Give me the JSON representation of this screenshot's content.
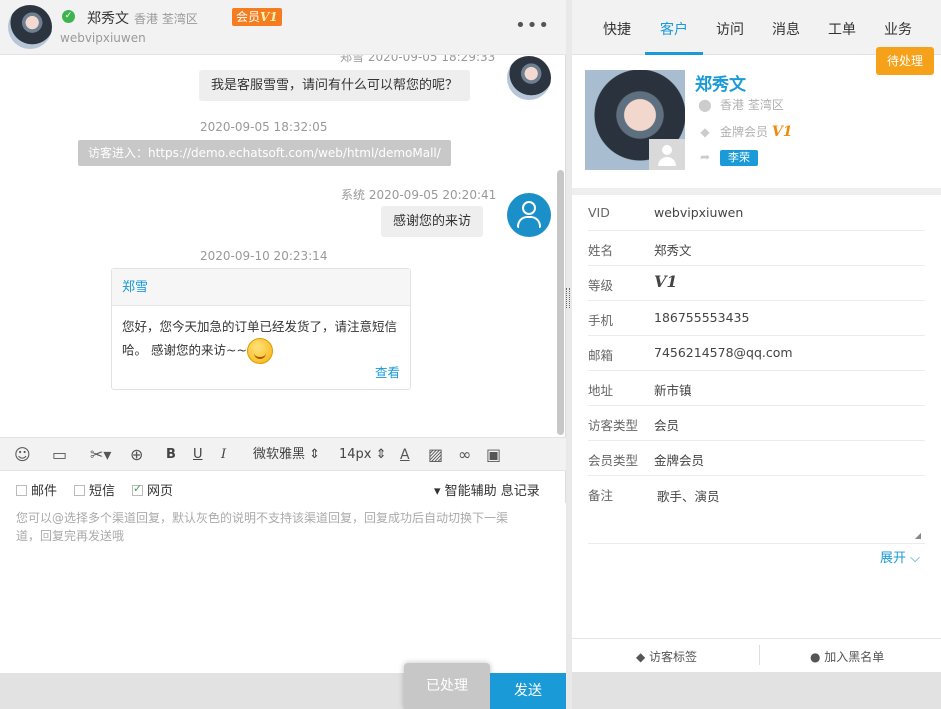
{
  "chat_header": {
    "name": "郑秀文",
    "region": "香港 荃湾区",
    "member_label": "会员",
    "member_level": "V1",
    "vid": "webvipxiuwen",
    "more": "•••"
  },
  "messages": {
    "msg1_meta": "郑雪  2020-09-05 18:29:33",
    "msg1_text": "我是客服雪雪，请问有什么可以帮您的呢？",
    "ts2": "2020-09-05 18:32:05",
    "visitor_enter": "访客进入：https://demo.echatsoft.com/web/html/demoMall/",
    "msg3_meta": "系统  2020-09-05 20:20:41",
    "msg3_text": "感谢您的来访",
    "ts4": "2020-09-10 20:23:14",
    "card_title": "郑雪",
    "card_text": "您好，您今天加急的订单已经发货了，请注意短信哈。 感谢您的来访~~",
    "card_link": "查看"
  },
  "toolbar": {
    "font": "微软雅黑 ⇕",
    "size": "14px ⇕",
    "bold": "B",
    "underline": "U",
    "italic": "I"
  },
  "channels": {
    "mail": "邮件",
    "sms": "短信",
    "web": "网页",
    "assist": "▾ 智能辅助 息记录"
  },
  "compose": {
    "placeholder": "您可以@选择多个渠道回复，默认灰色的说明不支持该渠道回复，回复成功后自动切换下一渠道，回复完再发送哦"
  },
  "buttons": {
    "done": "已处理",
    "send": "发送",
    "pending": "待处理"
  },
  "tabs": [
    "快捷",
    "客户",
    "访问",
    "消息",
    "工单",
    "业务"
  ],
  "profile": {
    "name": "郑秀文",
    "location": "香港 荃湾区",
    "level_name": "金牌会员",
    "level": "V1",
    "agent": "李荣"
  },
  "fields": [
    {
      "label": "VID",
      "value": "webvipxiuwen"
    },
    {
      "label": "姓名",
      "value": "郑秀文"
    },
    {
      "label": "等级",
      "value": "V1"
    },
    {
      "label": "手机",
      "value": "186755553435"
    },
    {
      "label": "邮箱",
      "value": "7456214578@qq.com"
    },
    {
      "label": "地址",
      "value": "新市镇"
    },
    {
      "label": "访客类型",
      "value": "会员"
    },
    {
      "label": "会员类型",
      "value": "金牌会员"
    },
    {
      "label": "备注",
      "value": "歌手、演员"
    }
  ],
  "expand": "展开 ⌵",
  "actions": {
    "tags": "访客标签",
    "blacklist": "加入黑名单"
  },
  "colors": {
    "accent": "#1a9bd7",
    "member_orange": "#f57d1f",
    "pending_orange": "#f5a11a"
  }
}
